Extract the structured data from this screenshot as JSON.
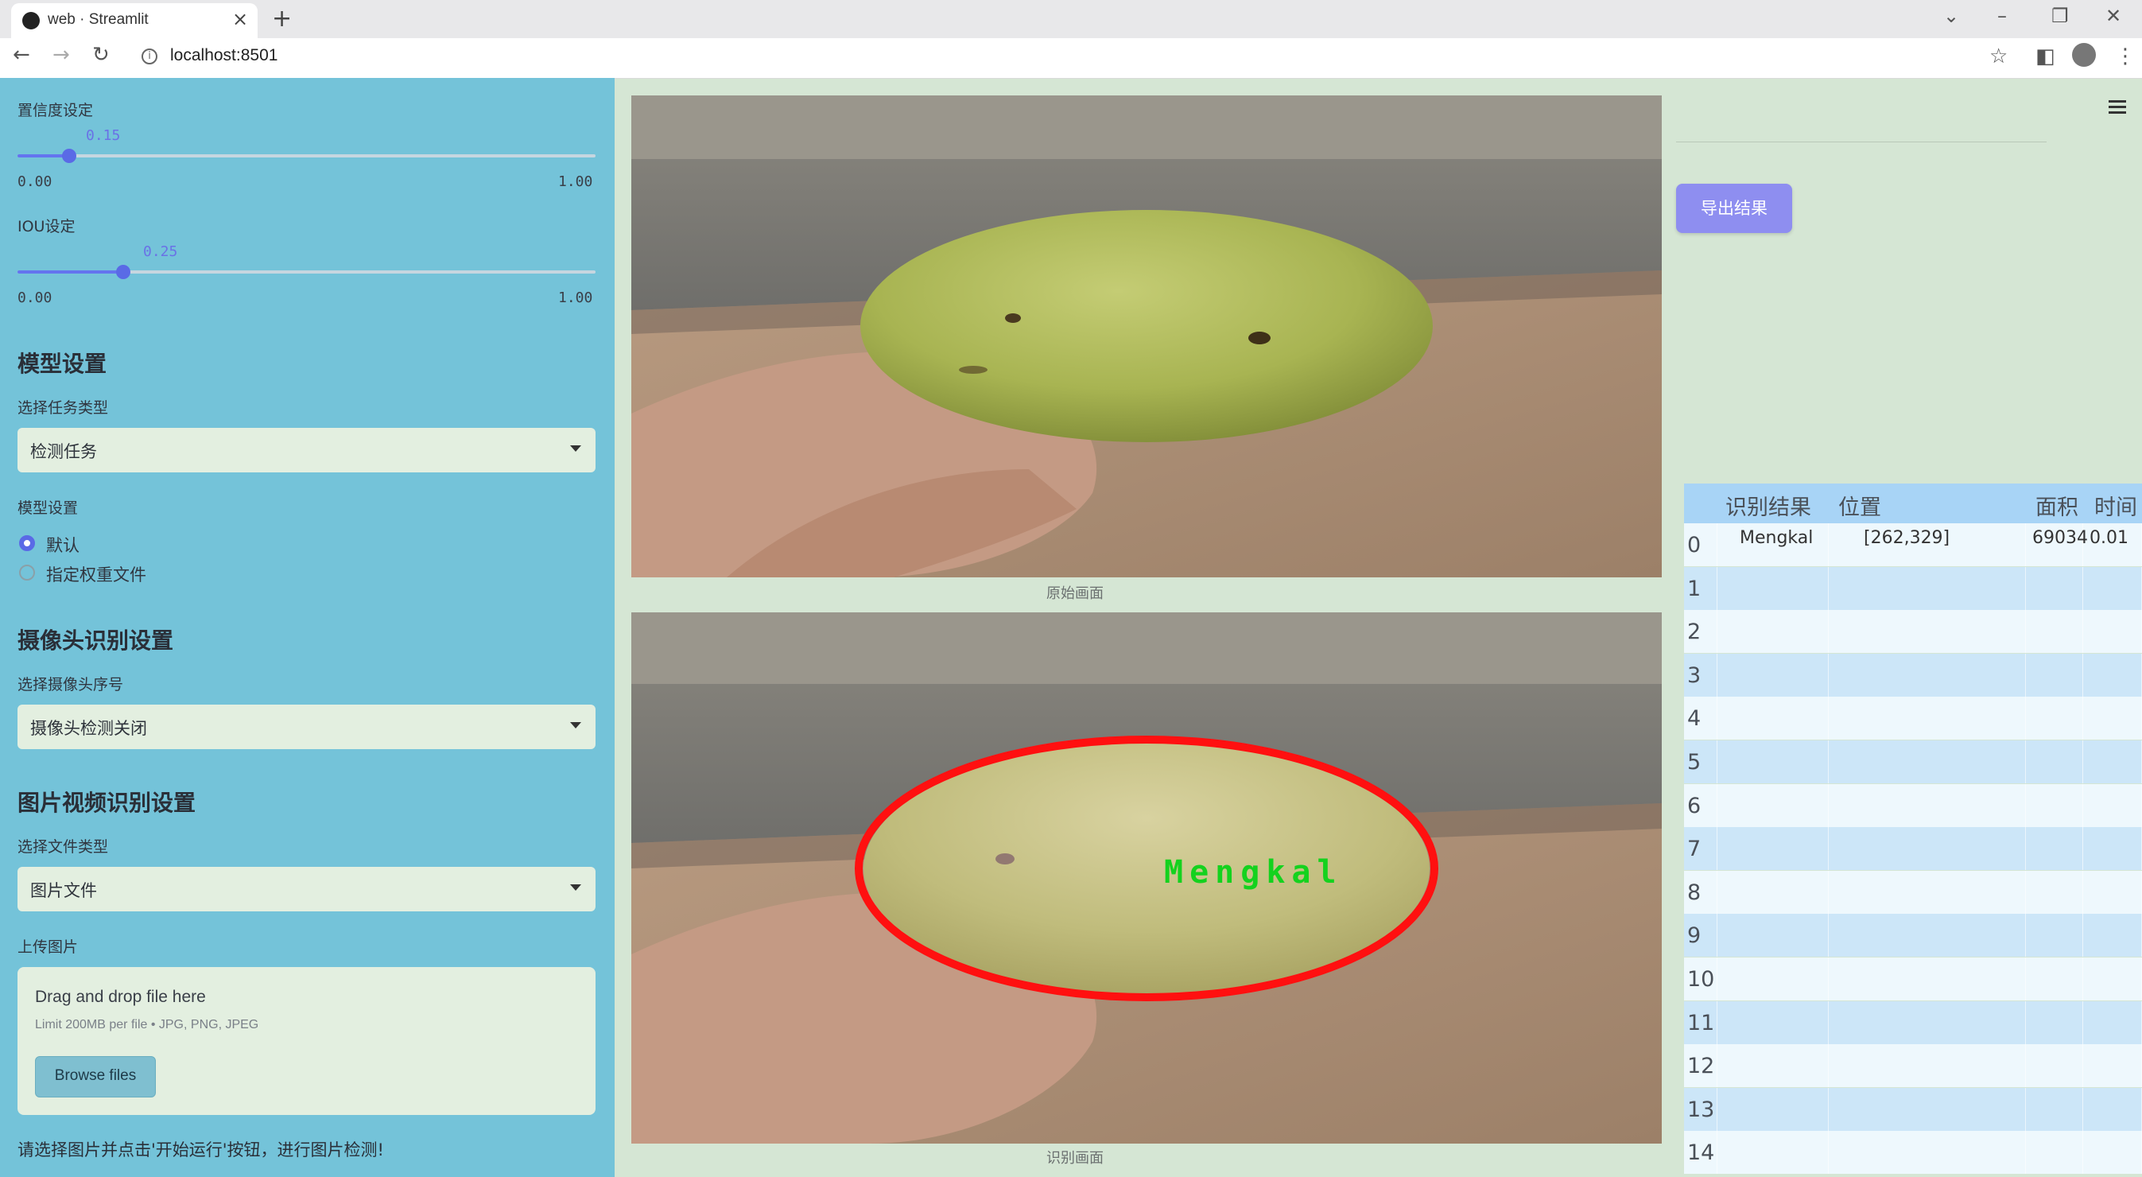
{
  "browser": {
    "tab_title": "web · Streamlit",
    "url": "localhost:8501"
  },
  "sidebar": {
    "confidence": {
      "label": "置信度设定",
      "value": "0.15",
      "min": "0.00",
      "max": "1.00",
      "fraction": 0.15
    },
    "iou": {
      "label": "IOU设定",
      "value": "0.25",
      "min": "0.00",
      "max": "1.00",
      "fraction": 0.25
    },
    "model_section": {
      "title": "模型设置",
      "task_label": "选择任务类型",
      "task_value": "检测任务",
      "model_label": "模型设置",
      "options": [
        "默认",
        "指定权重文件"
      ],
      "selected": 0
    },
    "camera_section": {
      "title": "摄像头识别设置",
      "camera_label": "选择摄像头序号",
      "camera_value": "摄像头检测关闭"
    },
    "media_section": {
      "title": "图片视频识别设置",
      "filetype_label": "选择文件类型",
      "filetype_value": "图片文件",
      "upload_label": "上传图片",
      "drop_text": "Drag and drop file here",
      "limit_text": "Limit 200MB per file • JPG, PNG, JPEG",
      "browse_label": "Browse files"
    },
    "hint": "请选择图片并点击'开始运行'按钮，进行图片检测!"
  },
  "main": {
    "original_caption": "原始画面",
    "result_caption": "识别画面",
    "detection_label": "Mengkal",
    "export_label": "导出结果"
  },
  "table": {
    "columns": [
      "识别结果",
      "位置",
      "面积",
      "时间"
    ],
    "rows": [
      {
        "index": "0",
        "result": "Mengkal",
        "position": "[262,329]",
        "area": "69034",
        "time": "0.01"
      },
      {
        "index": "1"
      },
      {
        "index": "2"
      },
      {
        "index": "3"
      },
      {
        "index": "4"
      },
      {
        "index": "5"
      },
      {
        "index": "6"
      },
      {
        "index": "7"
      },
      {
        "index": "8"
      },
      {
        "index": "9"
      },
      {
        "index": "10"
      },
      {
        "index": "11"
      },
      {
        "index": "12"
      },
      {
        "index": "13"
      },
      {
        "index": "14"
      }
    ]
  },
  "colors": {
    "sidebar_bg": "#74c3d9",
    "main_bg": "#d5e6d4",
    "accent": "#6474ef",
    "export_button": "#8e8ef0",
    "detection_box": "#ff1010",
    "detection_text": "#14d21e"
  }
}
